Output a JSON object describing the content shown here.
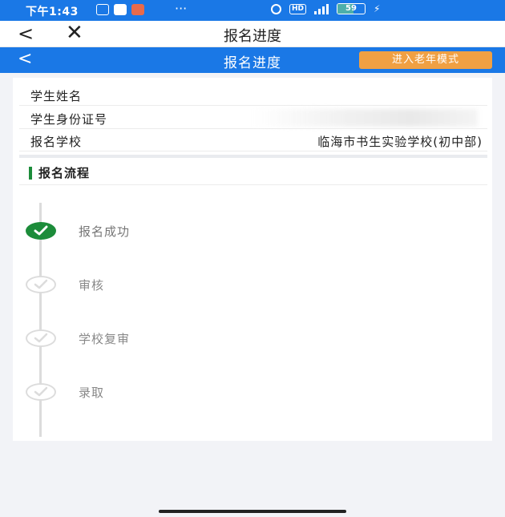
{
  "status_bar": {
    "time": "下午1:43",
    "dots": "···",
    "hd": "HD",
    "battery": "59"
  },
  "nav": {
    "back_icon": "<",
    "close_icon": "✕",
    "title": "报名进度"
  },
  "header": {
    "back_icon": "<",
    "title": "报名进度",
    "elder_mode_label": "进入老年模式"
  },
  "student_info": [
    {
      "label": "学生姓名",
      "value": ""
    },
    {
      "label": "学生身份证号",
      "value": ""
    },
    {
      "label": "报名学校",
      "value": "临海市书生实验学校(初中部)"
    }
  ],
  "section": {
    "title": "报名流程"
  },
  "steps": [
    {
      "label": "报名成功",
      "status": "done"
    },
    {
      "label": "审核",
      "status": "pending"
    },
    {
      "label": "学校复审",
      "status": "pending"
    },
    {
      "label": "录取",
      "status": "pending"
    }
  ],
  "colors": {
    "primary_blue": "#1a78e6",
    "elder_button": "#f0a043",
    "success_green": "#1c8c3a"
  }
}
